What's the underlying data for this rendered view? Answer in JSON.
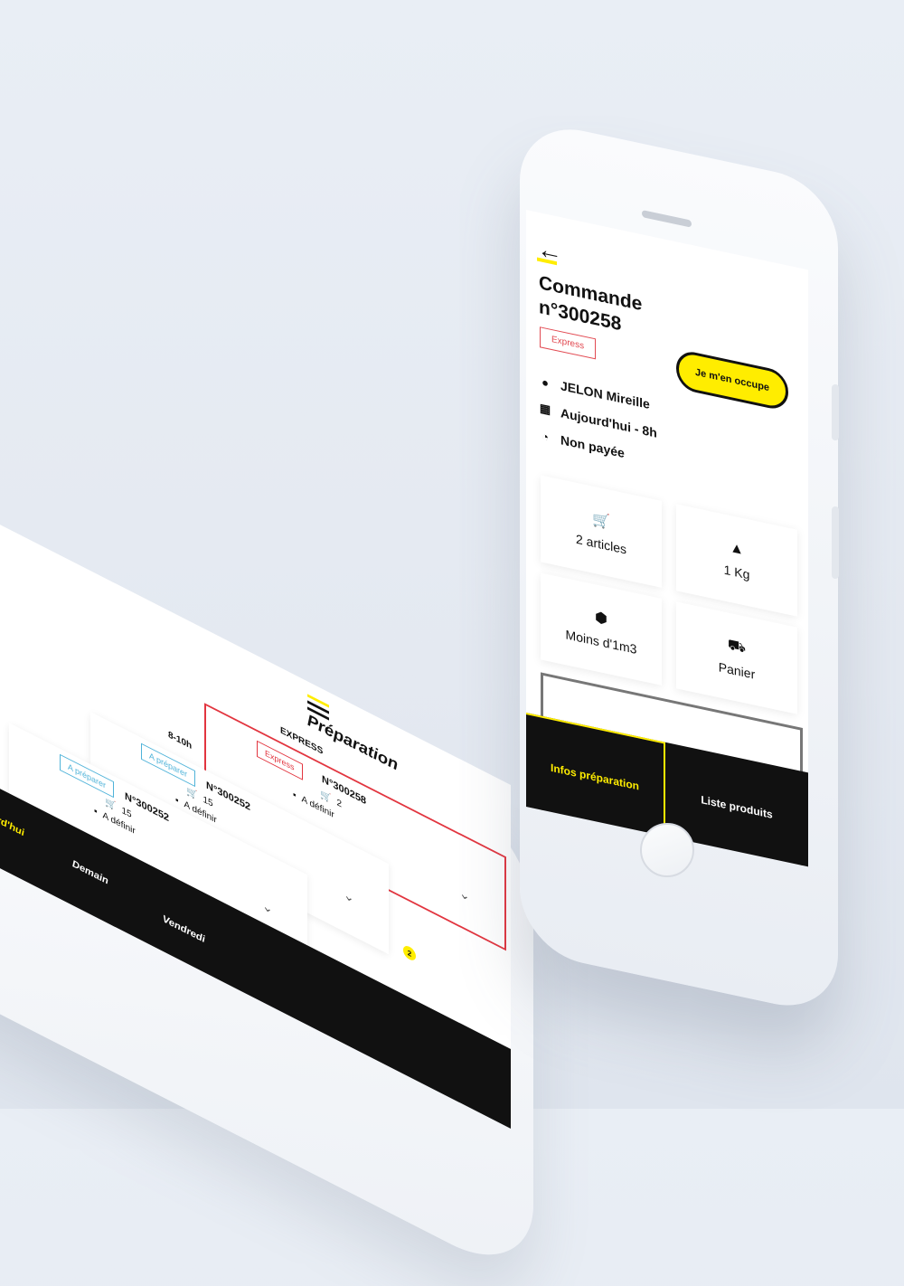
{
  "detail": {
    "back_icon": "arrow-left-icon",
    "title_line1": "Commande",
    "title_line2": "n°300258",
    "badge": "Express",
    "cta_label": "Je m'en occupe",
    "customer": "JELON Mireille",
    "date": "Aujourd'hui - 8h",
    "payment": "Non payée",
    "tiles": [
      {
        "icon": "cart-icon",
        "label": "2 articles"
      },
      {
        "icon": "weight-icon",
        "label": "1 Kg"
      },
      {
        "icon": "box-icon",
        "label": "Moins d'1m3"
      },
      {
        "icon": "trolley-icon",
        "label": "Panier"
      }
    ],
    "tabs": [
      "Infos préparation",
      "Liste produits"
    ]
  },
  "list": {
    "title": "Préparation",
    "section_express": "EXPRESS",
    "section_slot": "8-10h",
    "orders": [
      {
        "tag": "Express",
        "number": "N°300258",
        "count": "2",
        "date": "A définir"
      },
      {
        "tag": "A préparer",
        "number": "N°300252",
        "count": "15",
        "date": "A définir"
      },
      {
        "tag": "A préparer",
        "number": "N°300252",
        "count": "15",
        "date": "A définir"
      }
    ],
    "badge_count": "2",
    "tabs": [
      "urd'hui",
      "Demain",
      "Vendredi"
    ]
  },
  "colors": {
    "accent": "#ffed00",
    "express": "#e2353f",
    "prepare": "#4fb3d9",
    "dark": "#111111"
  }
}
